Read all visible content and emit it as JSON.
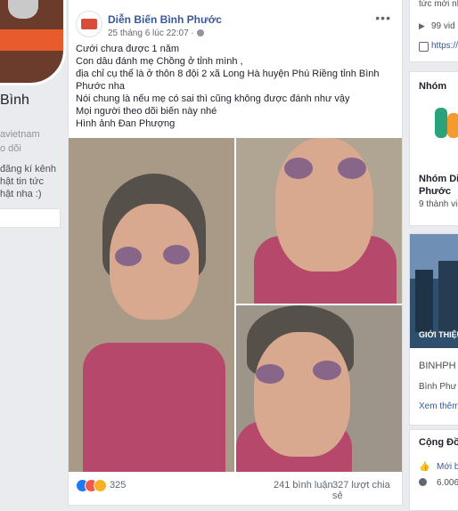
{
  "left_sidebar": {
    "name": "Bình",
    "sub1": "avietnam",
    "sub2": "o dõi",
    "text_lines": [
      "đăng kí kênh",
      "hật tin tức",
      "hật nha :)"
    ]
  },
  "post": {
    "page_name": "Diễn Biến Bình Phước",
    "time": "25 tháng 6 lúc 22:07 ·",
    "menu": "•••",
    "text_lines": [
      "Cưới chưa được 1 năm",
      "Con dâu đánh mẹ Chồng ở tỉnh mình ,",
      "địa chỉ cụ thể là ở thôn 8 đội 2 xã Long Hà huyện Phú Riềng tỉnh Bình Phước nha",
      "Nói chung là nếu mẹ có sai thì cũng không được đánh như vậy",
      "Mọi người theo dõi biến này nhé",
      "Hình ảnh Đan Phượng"
    ],
    "reaction_count": "325",
    "comments": "241 bình luận",
    "shares": "327 lượt chia sẻ"
  },
  "right_sidebar": {
    "top_text": "tức mới nhấ",
    "views": "99 vid",
    "link": "https://",
    "group_header": "Nhóm",
    "group_name1": "Nhóm Diễ",
    "group_name2": "Phước",
    "group_members": "9 thành viê",
    "city_caption": "GIỚI THIỆU",
    "page1": "BINHPH",
    "page2": "Bình Phư",
    "see_more": "Xem thêm",
    "community": "Cộng Đồn",
    "new_label": "Mới b",
    "count": "6.006"
  },
  "colors": {
    "link_blue": "#385898",
    "bg": "#e9ebee"
  }
}
